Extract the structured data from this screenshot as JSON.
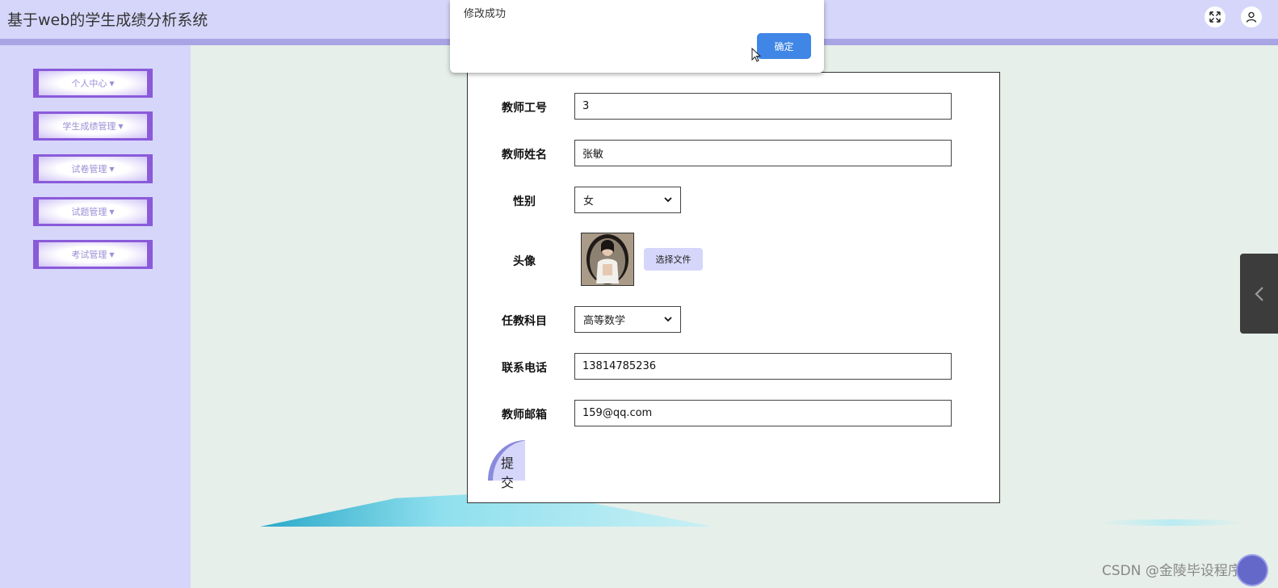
{
  "header": {
    "title": "基于web的学生成绩分析系统",
    "fullscreen_icon": "expand-icon",
    "user_icon": "user-icon"
  },
  "sidebar": {
    "items": [
      {
        "label": "个人中心"
      },
      {
        "label": "学生成绩管理"
      },
      {
        "label": "试卷管理"
      },
      {
        "label": "试题管理"
      },
      {
        "label": "考试管理"
      }
    ]
  },
  "form": {
    "fields": {
      "teacher_id": {
        "label": "教师工号",
        "value": "3"
      },
      "teacher_name": {
        "label": "教师姓名",
        "value": "张敏"
      },
      "gender": {
        "label": "性别",
        "value": "女"
      },
      "avatar": {
        "label": "头像",
        "choose_label": "选择文件"
      },
      "subject": {
        "label": "任教科目",
        "value": "高等数学"
      },
      "phone": {
        "label": "联系电话",
        "value": "13814785236"
      },
      "email": {
        "label": "教师邮箱",
        "value": "159@qq.com"
      }
    },
    "submit_label": "提交"
  },
  "dialog": {
    "message": "修改成功",
    "ok_label": "确定"
  },
  "watermark": "CSDN @金陵毕设程序",
  "colors": {
    "header_bg": "#d6d6fb",
    "sidebar_accent": "#8a5bd9",
    "primary_button": "#3f86e6",
    "page_bg": "#e6efea"
  }
}
